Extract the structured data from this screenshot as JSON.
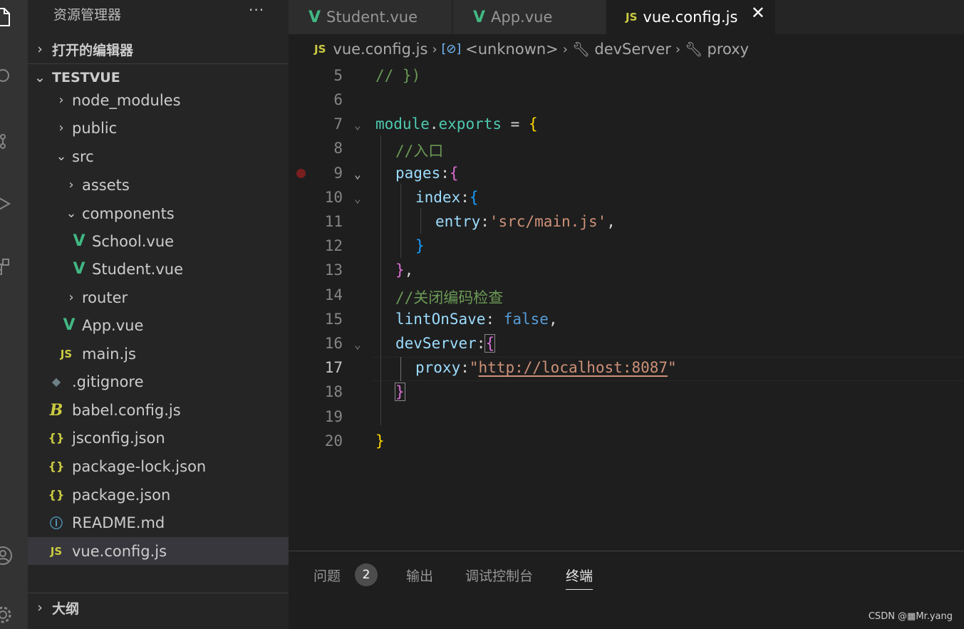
{
  "sidebar": {
    "title": "资源管理器",
    "more_label": "···",
    "open_editors_label": "打开的编辑器",
    "project_label": "TESTVUE",
    "outline_label": "大纲",
    "tree": [
      {
        "label": "node_modules",
        "type": "folder",
        "expanded": false
      },
      {
        "label": "public",
        "type": "folder",
        "expanded": false
      },
      {
        "label": "src",
        "type": "folder",
        "expanded": true
      },
      {
        "label": "assets",
        "type": "folder",
        "expanded": false
      },
      {
        "label": "components",
        "type": "folder",
        "expanded": true
      },
      {
        "label": "School.vue",
        "type": "vue"
      },
      {
        "label": "Student.vue",
        "type": "vue"
      },
      {
        "label": "router",
        "type": "folder",
        "expanded": false
      },
      {
        "label": "App.vue",
        "type": "vue"
      },
      {
        "label": "main.js",
        "type": "js"
      },
      {
        "label": ".gitignore",
        "type": "git"
      },
      {
        "label": "babel.config.js",
        "type": "babel"
      },
      {
        "label": "jsconfig.json",
        "type": "json"
      },
      {
        "label": "package-lock.json",
        "type": "json"
      },
      {
        "label": "package.json",
        "type": "json"
      },
      {
        "label": "README.md",
        "type": "info"
      },
      {
        "label": "vue.config.js",
        "type": "js",
        "selected": true
      }
    ]
  },
  "icons": {
    "vue": "V",
    "js": "JS",
    "json": "{}",
    "info": "ⓘ",
    "git": "◆",
    "babel": "B",
    "chevron_right": "›",
    "chevron_down": "⌄",
    "close": "✕"
  },
  "tabs": [
    {
      "label": "Student.vue",
      "icon": "vue"
    },
    {
      "label": "App.vue",
      "icon": "vue"
    },
    {
      "label": "vue.config.js",
      "icon": "js",
      "active": true
    }
  ],
  "breadcrumb": {
    "file": "vue.config.js",
    "symbol1": "<unknown>",
    "symbol2": "devServer",
    "symbol3": "proxy"
  },
  "editor": {
    "current_line": 17,
    "breakpoint_line": 9,
    "line_numbers": [
      "5",
      "6",
      "7",
      "8",
      "9",
      "10",
      "11",
      "12",
      "13",
      "14",
      "15",
      "16",
      "17",
      "18",
      "19",
      "20"
    ],
    "code": {
      "l5": "// })",
      "l7_a": "module",
      "l7_b": ".",
      "l7_c": "exports",
      "l7_d": " = ",
      "l7_e": "{",
      "l8": "//入口",
      "l9_a": "pages",
      "l9_b": ":",
      "l9_c": "{",
      "l10_a": "index",
      "l10_b": ":",
      "l10_c": "{",
      "l11_a": "entry",
      "l11_b": ":",
      "l11_c": "'src/main.js'",
      "l11_d": ",",
      "l12": "}",
      "l13_a": "}",
      "l13_b": ",",
      "l14": "//关闭编码检查",
      "l15_a": "lintOnSave",
      "l15_b": ": ",
      "l15_c": "false",
      "l15_d": ",",
      "l16_a": "devServer",
      "l16_b": ":",
      "l16_c": "{",
      "l17_a": "proxy",
      "l17_b": ":",
      "l17_c": "\"",
      "l17_d": "http://localhost:8087",
      "l17_e": "\"",
      "l18": "}",
      "l20": "}"
    }
  },
  "panel": {
    "tabs": [
      "问题",
      "输出",
      "调试控制台",
      "终端"
    ],
    "problems_count": "2",
    "active_tab": "终端"
  },
  "watermark": "CSDN @▦Mr.yang",
  "colors": {
    "vue": "#41b883",
    "js": "#cbcb41",
    "comment": "#6a9955",
    "string": "#ce9178",
    "keyword": "#569cd6",
    "property": "#9cdcfe"
  }
}
